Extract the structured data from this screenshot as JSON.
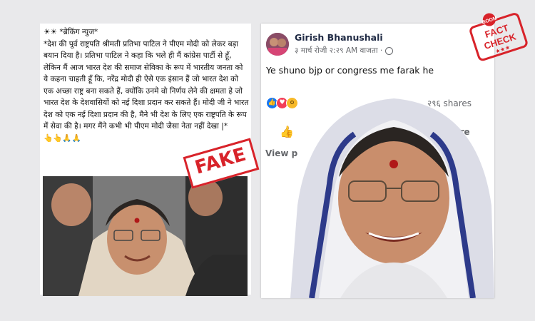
{
  "left_post": {
    "header": "☀☀ *ब्रेकिंग न्युज*",
    "body": "*देश की पूर्व राष्ट्रपति श्रीमती प्रतिभा पाटिल ने पीएम मोदी को लेकर बड़ा बयान दिया है। प्रतिभा पाटिल ने कहा कि भले ही मैं कांग्रेस पार्टी से हूँ, लेकिन मैं आज भारत देश की समाज सेविका के रूप में भारतीय जनता को ये कहना चाहती हूँ कि, नरेंद्र मोदी ही ऐसे एक इंसान हैं जो भारत देश को एक अच्छा राष्ट्र बना सकते हैं, क्योंकि उनमे वो निर्णय लेने की क्षमता हे जो भारत देश के देशवासियों को नई दिशा प्रदान कर सकते हैं। मोदी जी ने भारत देश को एक नई दिशा प्रदान की है, मैने भी देश के लिए एक राष्ट्रपति के रूप में सेवा की है। मगर मैंने कभी भी पीएम मोदी जैसा नेता नहीं देखा |*",
    "emojis": "👆👆🙏🙏",
    "stamp": "FAKE"
  },
  "right_post": {
    "author": "Girish Bhanushali",
    "timestamp": "३ मार्च रोजी २:२९ AM वाजता · ",
    "post_text": "Ye shuno bjp or congress me farak he",
    "shares_count": "२९६ shares",
    "share_button": "hare",
    "view_more": "View p"
  },
  "badge": {
    "brand": "BOOM",
    "line1": "FACT",
    "line2": "CHECK",
    "stars": "★★★"
  },
  "colors": {
    "stamp_red": "#d8232a",
    "facebook_gray": "#65676b",
    "like_blue": "#1877f2",
    "love_red": "#f33e58",
    "wow_yellow": "#f7b928"
  },
  "icons": {
    "globe": "globe-icon",
    "like": "thumbs-up-icon",
    "reactions": [
      "like-reaction-icon",
      "love-reaction-icon",
      "wow-reaction-icon"
    ]
  }
}
